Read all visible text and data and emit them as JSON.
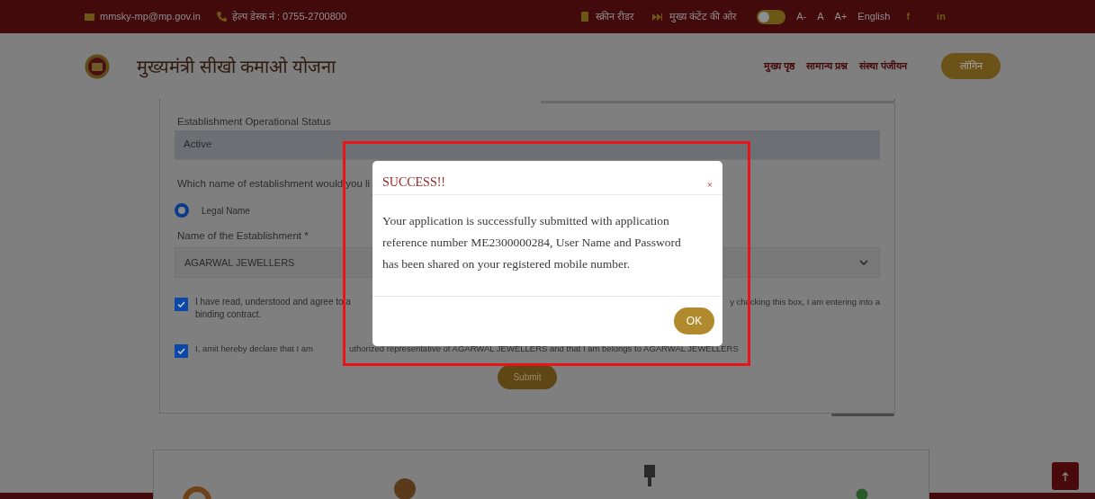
{
  "top_bar": {
    "email": "mmsky-mp@mp.gov.in",
    "helpdesk": "हेल्प डेस्क नं : 0755-2700800",
    "screen_reader": "स्क्रीन रीडर",
    "skip_to_content": "मुख्य कंटेंट की ओर",
    "contrast_toggle": {
      "on": false
    },
    "font_sizes": [
      "A-",
      "A",
      "A+"
    ],
    "language": "English",
    "social": [
      "f",
      "in"
    ]
  },
  "header": {
    "title": "मुख्यमंत्री सीखो कमाओ योजना",
    "nav": [
      "मुख्य पृष्ठ",
      "सामान्य प्रश्न",
      "संस्था पंजीयन"
    ],
    "login": "लॉगिन"
  },
  "form": {
    "status_label": "Establishment Operational Status",
    "status_value": "Active",
    "name_choice_label": "Which name of establishment would you li",
    "name_options": [
      {
        "label": "Legal Name",
        "selected": true
      }
    ],
    "name_label": "Name of the Establishment *",
    "name_value": "AGARWAL JEWELLERS",
    "agreements": [
      {
        "checked": true,
        "text_left": "I have read, understood and agree to a",
        "text_left_2": "binding contract.",
        "text_right": "y checking this box, I am entering into a"
      },
      {
        "checked": true,
        "text_left": "I, amit hereby declare that I am",
        "text_right": "uthorized representative of AGARWAL JEWELLERS and that I am belongs to AGARWAL JEWELLERS"
      }
    ],
    "submit": "Submit"
  },
  "modal": {
    "title": "SUCCESS!!",
    "close": "×",
    "message": "Your application is successfully submitted with application reference number ME2300000284, User Name and Password has been shared on your registered mobile number.",
    "ok": "OK"
  }
}
